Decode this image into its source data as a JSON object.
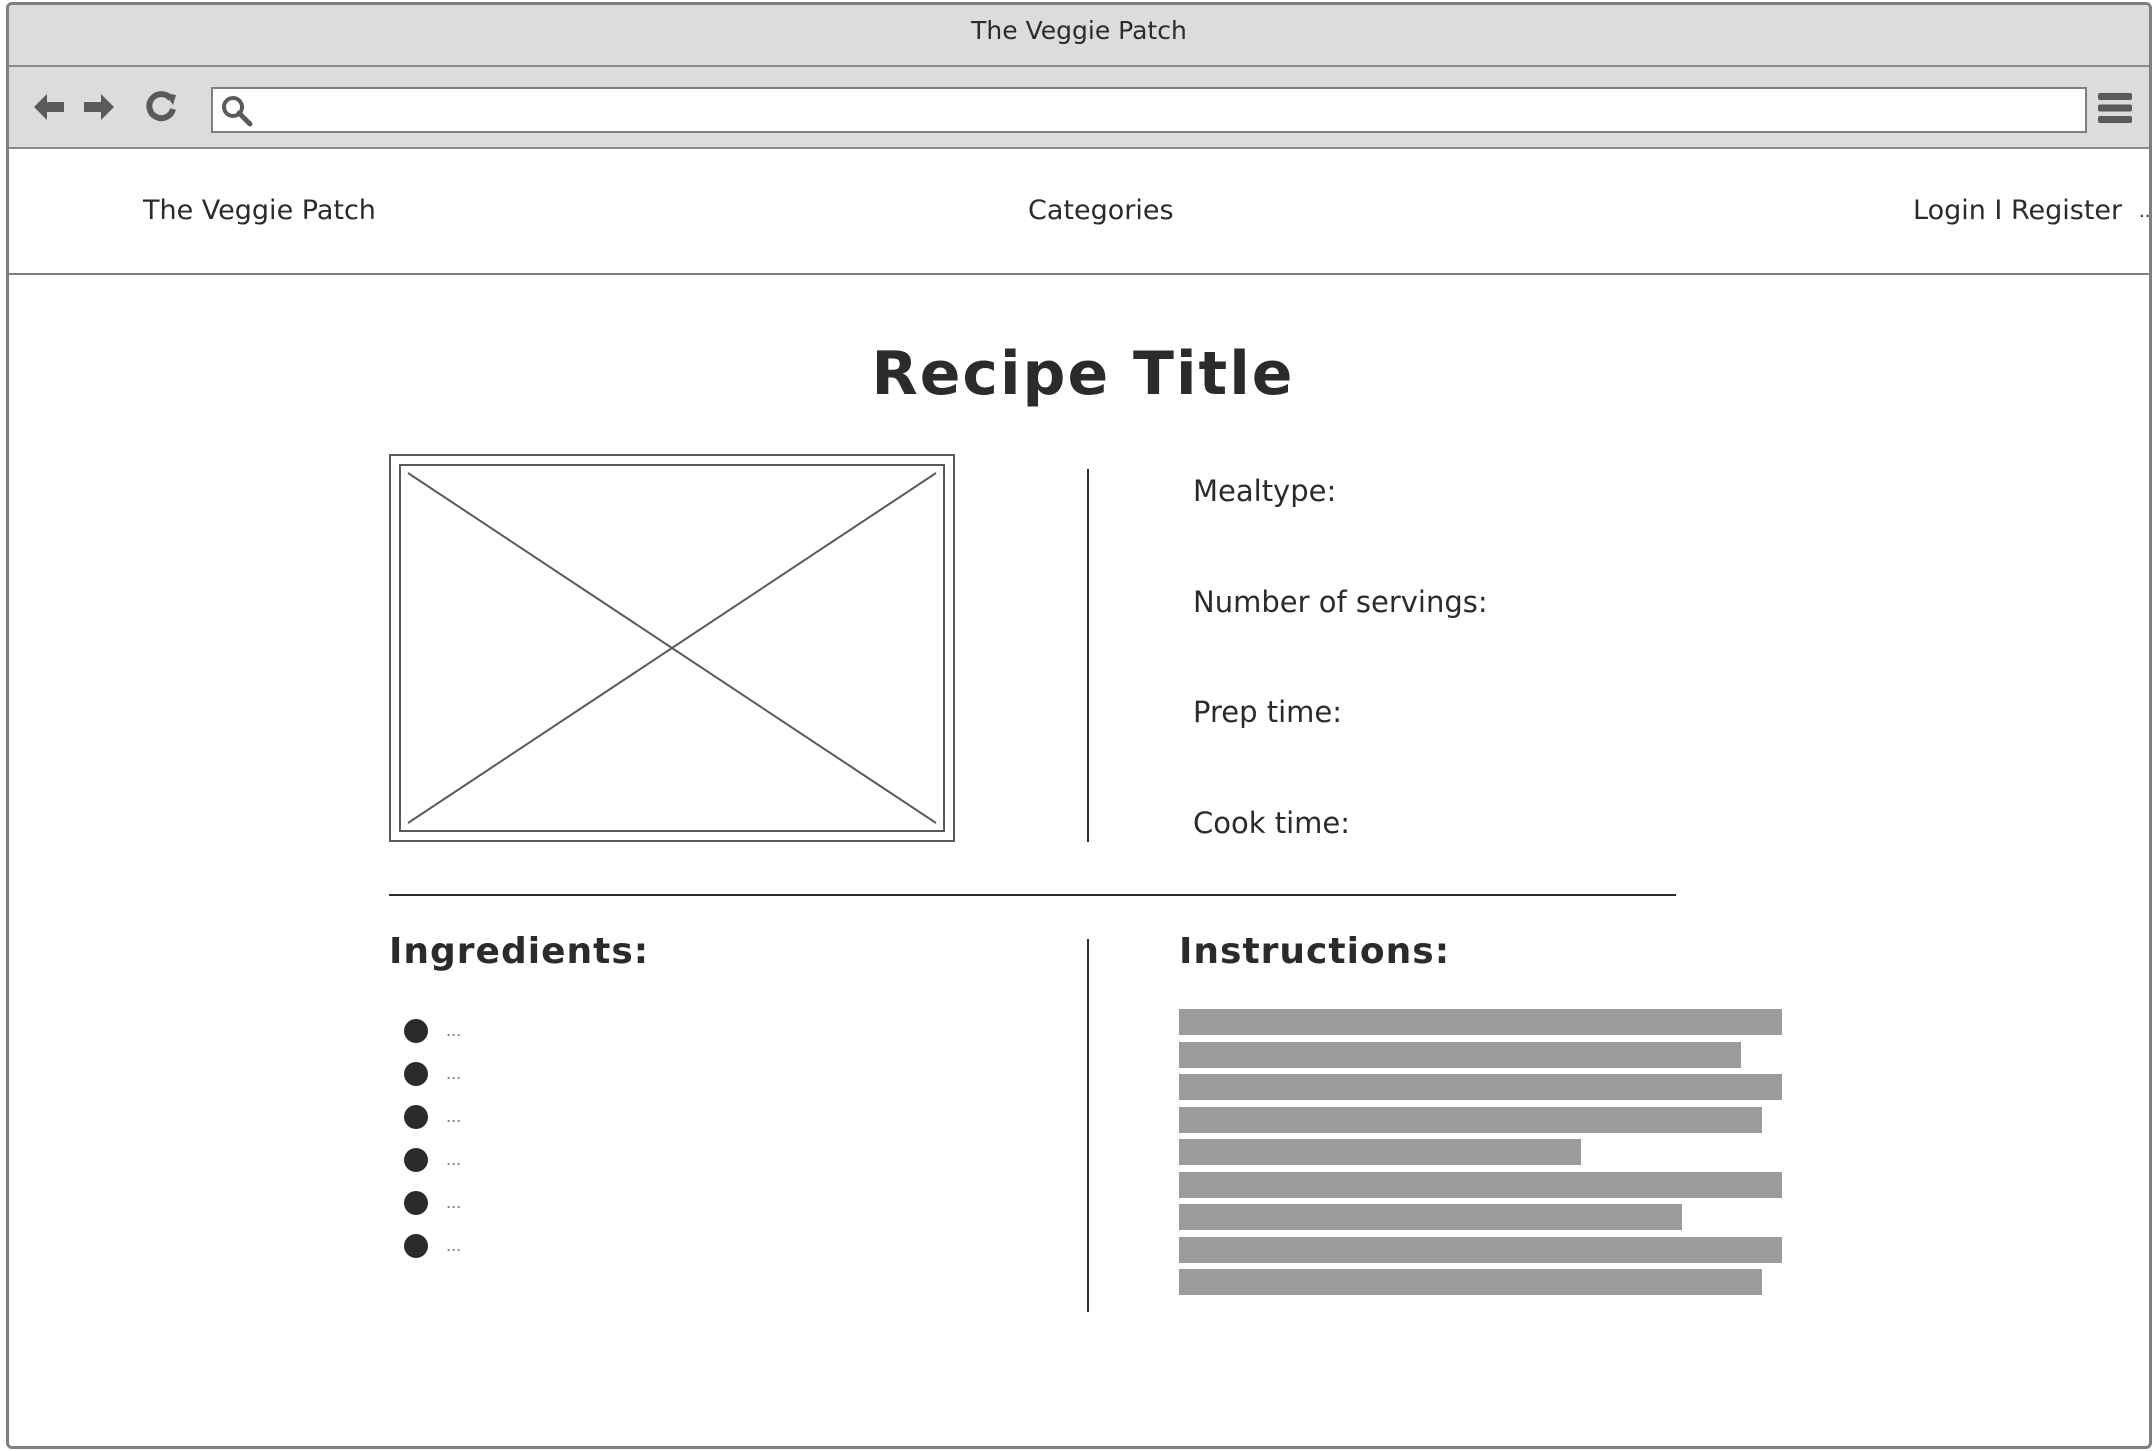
{
  "window": {
    "title": "The Veggie Patch"
  },
  "toolbar": {
    "back_icon": "arrow-left-icon",
    "forward_icon": "arrow-right-icon",
    "reload_icon": "reload-icon",
    "search_icon": "search-icon",
    "menu_icon": "hamburger-menu-icon",
    "address_value": ""
  },
  "nav": {
    "brand": "The Veggie Patch",
    "categories": "Categories",
    "login_register": "Login I Register",
    "overflow": "..."
  },
  "recipe": {
    "title": "Recipe Title",
    "image_placeholder_icon": "image-placeholder-icon",
    "meta": {
      "mealtype_label": "Mealtype:",
      "servings_label": "Number of servings:",
      "prep_label": "Prep time:",
      "cook_label": "Cook time:"
    },
    "ingredients": {
      "heading": "Ingredients:",
      "items": [
        "...",
        "...",
        "...",
        "...",
        "...",
        "..."
      ]
    },
    "instructions": {
      "heading": "Instructions:",
      "line_count": 9
    }
  },
  "colors": {
    "chrome_background": "#dcdcdc",
    "text": "#2b2b2b",
    "placeholder_text_bar": "#9b9b9b",
    "border": "#7f7f7f"
  }
}
